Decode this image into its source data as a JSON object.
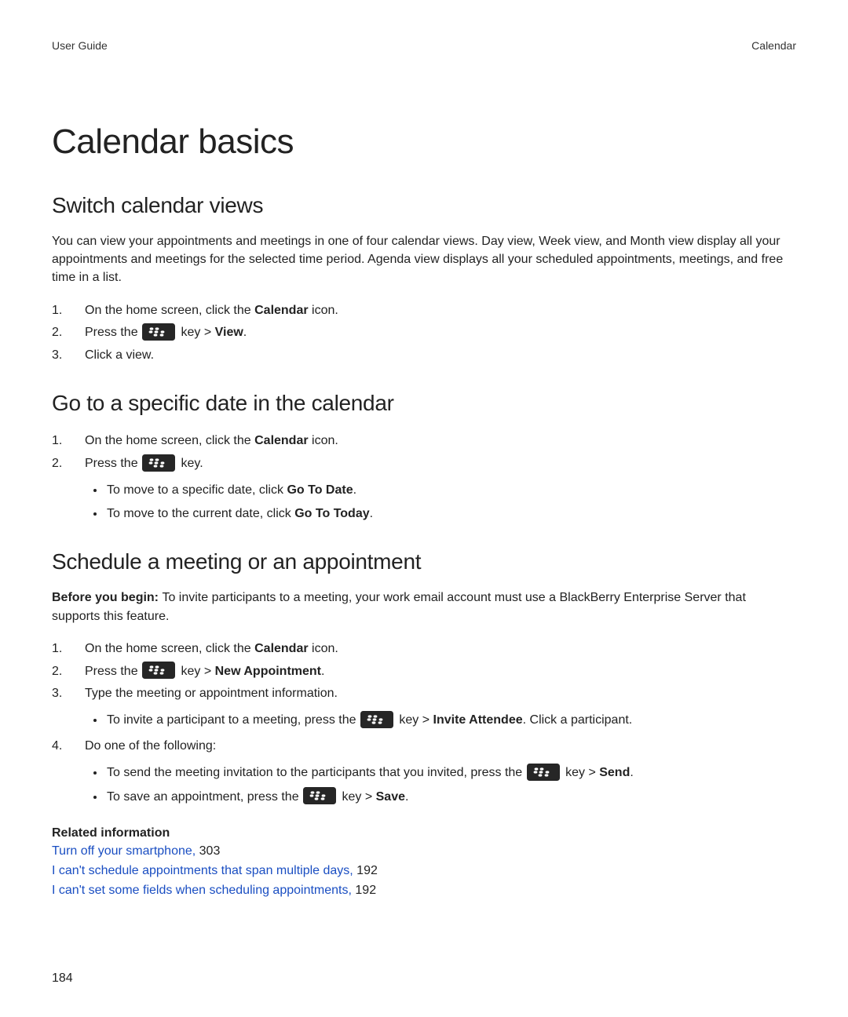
{
  "header": {
    "left": "User Guide",
    "right": "Calendar"
  },
  "title": "Calendar basics",
  "s1": {
    "heading": "Switch calendar views",
    "para": "You can view your appointments and meetings in one of four calendar views. Day view, Week view, and Month view display all your appointments and meetings for the selected time period. Agenda view displays all your scheduled appointments, meetings, and free time in a list.",
    "step1_a": "On the home screen, click the ",
    "step1_b": "Calendar",
    "step1_c": " icon.",
    "step2_a": "Press the ",
    "step2_b": " key > ",
    "step2_c": "View",
    "step2_d": ".",
    "step3": "Click a view."
  },
  "s2": {
    "heading": "Go to a specific date in the calendar",
    "step1_a": "On the home screen, click the ",
    "step1_b": "Calendar",
    "step1_c": " icon.",
    "step2_a": "Press the ",
    "step2_b": " key.",
    "b1_a": "To move to a specific date, click ",
    "b1_b": "Go To Date",
    "b1_c": ".",
    "b2_a": "To move to the current date, click ",
    "b2_b": "Go To Today",
    "b2_c": "."
  },
  "s3": {
    "heading": "Schedule a meeting or an appointment",
    "pre_a": "Before you begin: ",
    "pre_b": "To invite participants to a meeting, your work email account must use a BlackBerry Enterprise Server that supports this feature.",
    "step1_a": "On the home screen, click the ",
    "step1_b": "Calendar",
    "step1_c": " icon.",
    "step2_a": "Press the ",
    "step2_b": " key > ",
    "step2_c": "New Appointment",
    "step2_d": ".",
    "step3": "Type the meeting or appointment information.",
    "b3_a": "To invite a participant to a meeting, press the ",
    "b3_b": " key > ",
    "b3_c": "Invite Attendee",
    "b3_d": ". Click a participant.",
    "step4": "Do one of the following:",
    "b4a_a": "To send the meeting invitation to the participants that you invited, press the ",
    "b4a_b": " key > ",
    "b4a_c": "Send",
    "b4a_d": ".",
    "b4b_a": "To save an appointment, press the ",
    "b4b_b": " key > ",
    "b4b_c": "Save",
    "b4b_d": "."
  },
  "related": {
    "title": "Related information",
    "r1_link": "Turn off your smartphone, ",
    "r1_pg": "303",
    "r2_link": "I can't schedule appointments that span multiple days, ",
    "r2_pg": "192",
    "r3_link": "I can't set some fields when scheduling appointments, ",
    "r3_pg": "192"
  },
  "page_number": "184"
}
